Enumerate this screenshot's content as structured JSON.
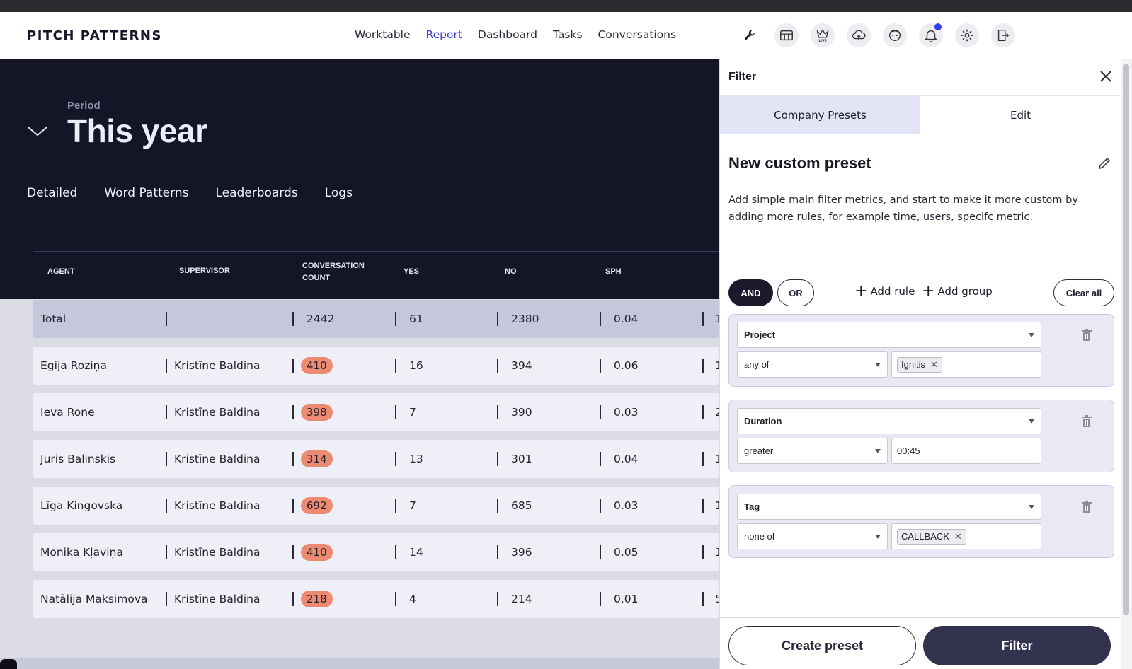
{
  "app": {
    "logo": "PITCH PATTERNS"
  },
  "nav": {
    "items": [
      {
        "label": "Worktable",
        "active": false
      },
      {
        "label": "Report",
        "active": true
      },
      {
        "label": "Dashboard",
        "active": false
      },
      {
        "label": "Tasks",
        "active": false
      },
      {
        "label": "Conversations",
        "active": false
      }
    ],
    "accent_color": "#3c43d8"
  },
  "header_icons": [
    "wrench-icon",
    "board-icon",
    "live-crown-icon",
    "upload-cloud-icon",
    "agent-face-icon",
    "bell-icon",
    "settings-icon",
    "logout-icon"
  ],
  "period": {
    "label": "Period",
    "value": "This year"
  },
  "tabs": [
    "Detailed",
    "Word Patterns",
    "Leaderboards",
    "Logs"
  ],
  "table": {
    "headers": {
      "agent": "AGENT",
      "supervisor": "SUPERVISOR",
      "count_line1": "CONVERSATION",
      "count_line2": "COUNT",
      "yes": "YES",
      "no": "NO",
      "sph": "SPH"
    },
    "total": {
      "label": "Total",
      "count": "2442",
      "yes": "61",
      "no": "2380",
      "sph": "0.04",
      "extra": "1"
    },
    "rows": [
      {
        "agent": "Egija Roziņa",
        "supervisor": "Kristīne Baldina",
        "count": "410",
        "yes": "16",
        "no": "394",
        "sph": "0.06",
        "extra": "1"
      },
      {
        "agent": "Ieva Rone",
        "supervisor": "Kristīne Baldina",
        "count": "398",
        "yes": "7",
        "no": "390",
        "sph": "0.03",
        "extra": "2"
      },
      {
        "agent": "Juris Balinskis",
        "supervisor": "Kristīne Baldina",
        "count": "314",
        "yes": "13",
        "no": "301",
        "sph": "0.04",
        "extra": "1"
      },
      {
        "agent": "Līga Kingovska",
        "supervisor": "Kristīne Baldina",
        "count": "692",
        "yes": "7",
        "no": "685",
        "sph": "0.03",
        "extra": "1"
      },
      {
        "agent": "Monika Kļaviņa",
        "supervisor": "Kristīne Baldina",
        "count": "410",
        "yes": "14",
        "no": "396",
        "sph": "0.05",
        "extra": "1"
      },
      {
        "agent": "Natālija Maksimova",
        "supervisor": "Kristīne Baldina",
        "count": "218",
        "yes": "4",
        "no": "214",
        "sph": "0.01",
        "extra": "5"
      }
    ],
    "pill_color": "#ec8a72"
  },
  "filter": {
    "title": "Filter",
    "tabs": [
      {
        "label": "Company Presets",
        "active": true
      },
      {
        "label": "Edit",
        "active": false
      }
    ],
    "preset_title": "New custom preset",
    "description": "Add simple main filter metrics, and start to make it more custom by adding more rules, for example time, users, specifc metric.",
    "and_label": "AND",
    "or_label": "OR",
    "add_rule_label": "Add rule",
    "add_group_label": "Add group",
    "clear_all_label": "Clear all",
    "rules": [
      {
        "field": "Project",
        "operator": "any of",
        "value_type": "chip",
        "value": "Ignitis"
      },
      {
        "field": "Duration",
        "operator": "greater",
        "value_type": "text",
        "value": "00:45"
      },
      {
        "field": "Tag",
        "operator": "none of",
        "value_type": "chip",
        "value": "CALLBACK"
      }
    ],
    "create_preset_label": "Create preset",
    "filter_button_label": "Filter"
  }
}
